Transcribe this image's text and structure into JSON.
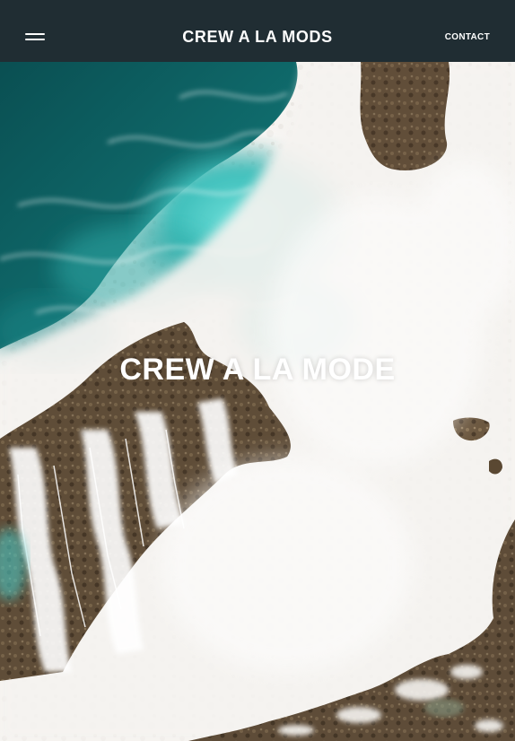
{
  "header": {
    "brand": "CREW A LA MODS",
    "contact_label": "CONTACT",
    "menu_icon": "hamburger-menu-icon"
  },
  "hero": {
    "title": "CREW A LA MODE",
    "image": "aerial-ocean-waves-on-rocks"
  },
  "colors": {
    "header_bg": "#202d33",
    "header_text": "#ffffff",
    "deep_water": "#0d5e60",
    "turquoise": "#42c3c0",
    "foam": "#f6f4f1",
    "rock": "#6f5a3f"
  }
}
